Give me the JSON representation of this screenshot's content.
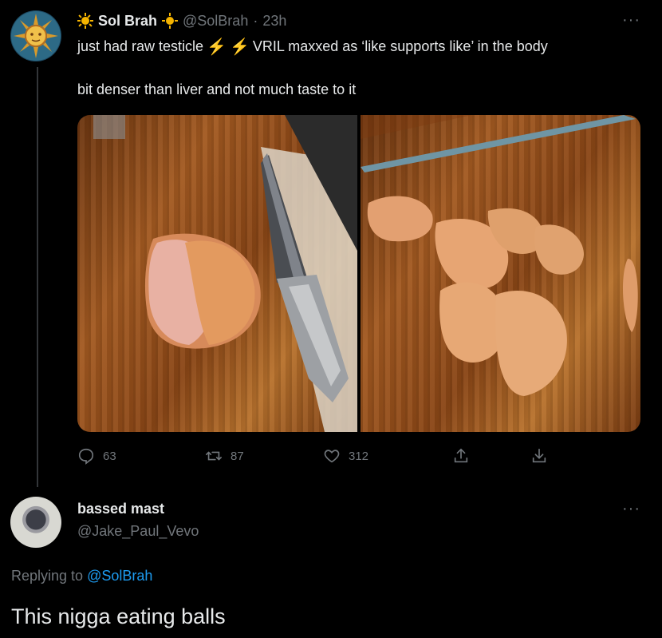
{
  "tweet": {
    "author_name": "Sol Brah",
    "author_handle": "@SolBrah",
    "separator": "·",
    "time": "23h",
    "text_before": "just had raw testicle",
    "text_after": "VRIL maxxed as ‘like supports like’ in the body",
    "text_line2": "bit denser than liver and not much taste to it",
    "emoji_icons": [
      "sun-emoji",
      "lightning-emoji"
    ],
    "replies": "63",
    "retweets": "87",
    "likes": "312",
    "more_label": "···"
  },
  "reply": {
    "author_name": "bassed mast",
    "author_handle": "@Jake_Paul_Vevo",
    "replying_prefix": "Replying to",
    "replying_handle": "@SolBrah",
    "text": "This nigga eating balls",
    "more_label": "···"
  },
  "colors": {
    "background": "#000000",
    "text_primary": "#e7e9ea",
    "text_secondary": "#71767b",
    "link": "#1d9bf0",
    "emoji_yellow": "#f5b400"
  }
}
